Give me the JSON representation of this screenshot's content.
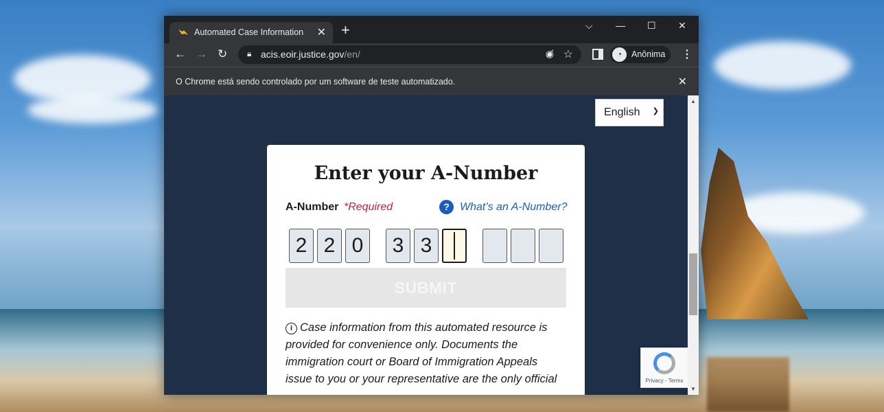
{
  "browser": {
    "tab_title": "Automated Case Information",
    "tab_close": "✕",
    "new_tab": "+",
    "controls": {
      "tabsearch": "⌵",
      "minimize": "—",
      "maximize": "☐",
      "close": "✕"
    },
    "nav": {
      "back": "←",
      "forward": "→",
      "reload": "↻"
    },
    "url_main": "acis.eoir.justice.gov",
    "url_path": "/en/",
    "profile_label": "Anônima",
    "menu": "⋮",
    "infobar_message": "O Chrome está sendo controlado por um software de teste automatizado.",
    "infobar_close": "✕"
  },
  "page": {
    "language_select": "English",
    "title": "Enter your A-Number",
    "label": "A-Number",
    "required": "*Required",
    "help_link": "What’s an A-Number?",
    "digits": [
      "2",
      "2",
      "0",
      "3",
      "3",
      "",
      "",
      "",
      ""
    ],
    "submit": "SUBMIT",
    "note": "Case information from this automated resource is provided for convenience only. Documents the immigration court or Board of Immigration Appeals issue to you or your representative are the only official"
  },
  "recaptcha": {
    "terms": "Privacy - Terms"
  },
  "colors": {
    "page_bg": "#1e2f47",
    "required": "#c9203c",
    "link": "#1a5dbe"
  }
}
